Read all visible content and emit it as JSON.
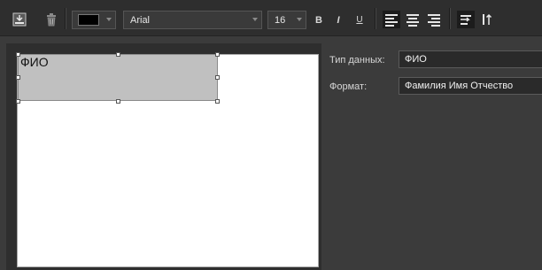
{
  "toolbar": {
    "insert_icon": "insert-field-icon",
    "delete_icon": "trash-icon",
    "color_picker": {
      "icon": "color-swatch-icon",
      "color": "#000000"
    },
    "font_family": "Arial",
    "font_size": "16",
    "bold_label": "B",
    "italic_label": "I",
    "underline_label": "U",
    "align": [
      "align-left-icon",
      "align-center-icon",
      "align-right-icon"
    ],
    "wrap_icon": "text-wrap-icon",
    "direction_icon": "text-direction-icon"
  },
  "canvas": {
    "field_text": "ФИО"
  },
  "properties": {
    "data_type": {
      "label": "Тип данных:",
      "value": "ФИО"
    },
    "format": {
      "label": "Формат:",
      "value": "Фамилия Имя Отчество"
    }
  },
  "colors": {
    "background": "#3b3b3b",
    "toolbar": "#2e2e2e",
    "field_fill": "#c0c0c0"
  }
}
